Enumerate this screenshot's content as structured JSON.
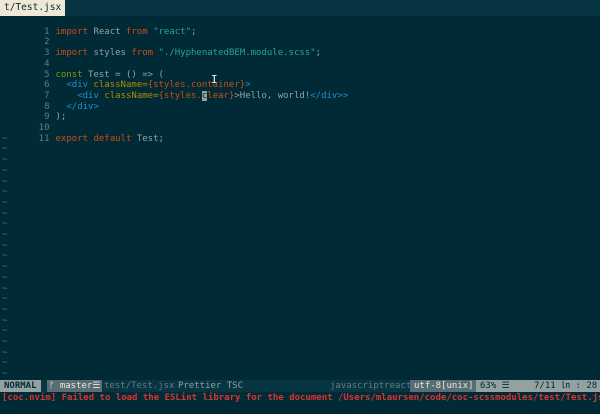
{
  "tabline": {
    "active_tab": "t/Test.jsx"
  },
  "buffer": {
    "lines": [
      {
        "n": "1"
      },
      {
        "n": "2"
      },
      {
        "n": "3"
      },
      {
        "n": "4"
      },
      {
        "n": "5"
      },
      {
        "n": "6"
      },
      {
        "n": "7"
      },
      {
        "n": "8"
      },
      {
        "n": "9"
      },
      {
        "n": "10"
      },
      {
        "n": "11"
      }
    ],
    "tokens": {
      "import": "import",
      "react_id": "React",
      "from": "from",
      "react_str": "\"react\"",
      "styles_id": "styles",
      "scss_str": "\"./HyphenatedBEM.module.scss\"",
      "const": "const",
      "test_decl": "Test = () => (",
      "div_open": "<div",
      "classname": "className=",
      "container_expr": "{styles.container}",
      "gt": ">",
      "div_inner_open": "<div",
      "classname2": "className=",
      "clear_pre": "{styles.",
      "clear_cursor": "c",
      "clear_post": "lear}",
      "hello": ">Hello, world!",
      "div_close_inner": "</div>",
      "div_close": "</div>",
      "paren_close": ");",
      "export": "export",
      "default": "default",
      "test_end": "Test;"
    },
    "tilde": "~"
  },
  "statusline": {
    "mode": "NORMAL",
    "branch": "ᚠ master☰",
    "file": "test/Test.jsx",
    "tools": "Prettier TSC",
    "filetype": "javascriptreact",
    "encoding": "utf-8[unix]",
    "percent": "63% ☰",
    "position": "7/11 ㏑ : 28"
  },
  "message": "[coc.nvim] Failed to load the ESLint library for the document /Users/mlaursen/code/coc-scssmodules/test/Test.jsx",
  "colors": {
    "background": "#002b36",
    "keyword": "#cb4b16",
    "string": "#2aa198",
    "tag": "#268bd2",
    "error": "#dc322f"
  }
}
